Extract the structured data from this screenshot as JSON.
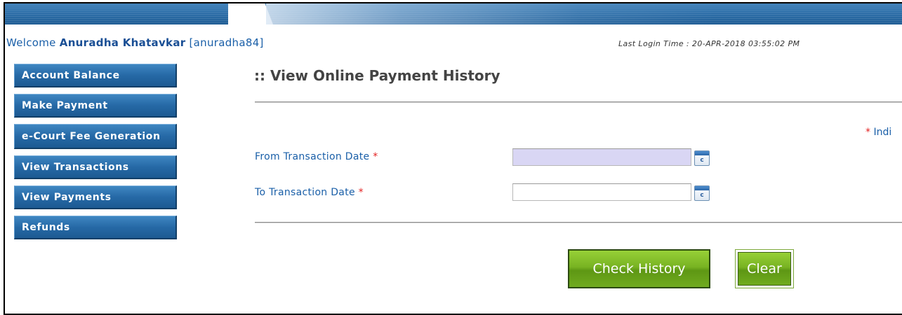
{
  "welcome": {
    "prefix": "Welcome",
    "user_name": "Anuradha Khatavkar",
    "username": "[anuradha84]"
  },
  "last_login": {
    "text": "Last Login Time : 20-APR-2018 03:55:02 PM"
  },
  "sidebar": {
    "items": [
      {
        "label": "Account Balance"
      },
      {
        "label": "Make Payment"
      },
      {
        "label": "e-Court Fee Generation"
      },
      {
        "label": "View Transactions"
      },
      {
        "label": "View Payments"
      },
      {
        "label": "Refunds"
      }
    ]
  },
  "main": {
    "title": ":: View Online Payment History",
    "indicates_label": "Indi",
    "required_marker": "*",
    "from_label": "From Transaction Date",
    "to_label": "To Transaction Date",
    "from_value": "",
    "to_value": "",
    "calendar_glyph": "c",
    "check_history_label": "Check History",
    "clear_label": "Clear"
  },
  "colors": {
    "accent_blue": "#1a5fa8",
    "sidebar_blue": "#2669a6",
    "button_green": "#78b322",
    "required_red": "#e32222",
    "from_field_bg": "#d9d6f4"
  },
  "icons": {
    "calendar": "calendar-icon"
  }
}
